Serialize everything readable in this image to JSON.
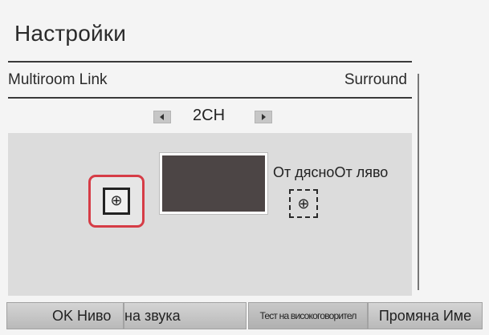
{
  "screen": {
    "title": "Настройки"
  },
  "menu": {
    "left_item": "Multiroom Link",
    "right_value": "Surround"
  },
  "channel_selector": {
    "value": "2CH",
    "left_arrow_icon": "arrow-left-icon",
    "right_arrow_icon": "arrow-right-icon"
  },
  "speaker_layout": {
    "position_label": "От дясноОт ляво",
    "speaker_glyph": "⊕",
    "focused_speaker": "left",
    "colors": {
      "focus_border": "#d63c46",
      "tv_fill": "#4c4545",
      "panel_background": "#dcdcdc"
    }
  },
  "bottom_bar": {
    "ok_label": "OK Ниво",
    "level_label": "на звука",
    "test_label": "Тест на високоговорител",
    "rename_label": "Промяна Име"
  }
}
